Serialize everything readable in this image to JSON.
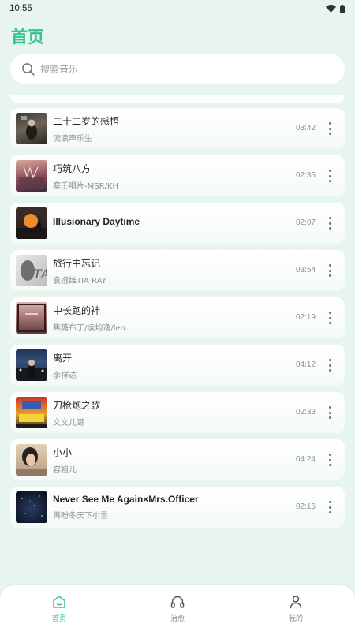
{
  "status_bar": {
    "time": "10:55"
  },
  "header": {
    "title": "首页"
  },
  "search": {
    "placeholder": "搜索音乐",
    "value": ""
  },
  "songs": [
    {
      "title": "二十二岁的感悟",
      "artist": "流浪声乐生",
      "duration": "03:42"
    },
    {
      "title": "巧筑八方",
      "artist": "塞壬唱片-MSR/KH",
      "duration": "02:35"
    },
    {
      "title": "Illusionary Daytime",
      "artist": "",
      "duration": "02:07"
    },
    {
      "title": "旅行中忘记",
      "artist": "袁娅维TIA RAY",
      "duration": "03:54"
    },
    {
      "title": "中长跑的神",
      "artist": "焦糖布丁/凌均逸/leo",
      "duration": "02:19"
    },
    {
      "title": "离开",
      "artist": "李祥达",
      "duration": "04:12"
    },
    {
      "title": "刀枪炮之歌",
      "artist": "文文儿哥",
      "duration": "02:33"
    },
    {
      "title": "小小",
      "artist": "容祖儿",
      "duration": "04:24"
    },
    {
      "title": "Never See Me Again×Mrs.Officer",
      "artist": "再盼冬天下小雪",
      "duration": "02:16"
    }
  ],
  "bottom_nav": [
    {
      "label": "首页",
      "icon": "home-icon",
      "active": true
    },
    {
      "label": "治愈",
      "icon": "headphones-icon",
      "active": false
    },
    {
      "label": "我的",
      "icon": "person-icon",
      "active": false
    }
  ],
  "colors": {
    "accent": "#34c38f",
    "background": "#e8f4ee"
  }
}
